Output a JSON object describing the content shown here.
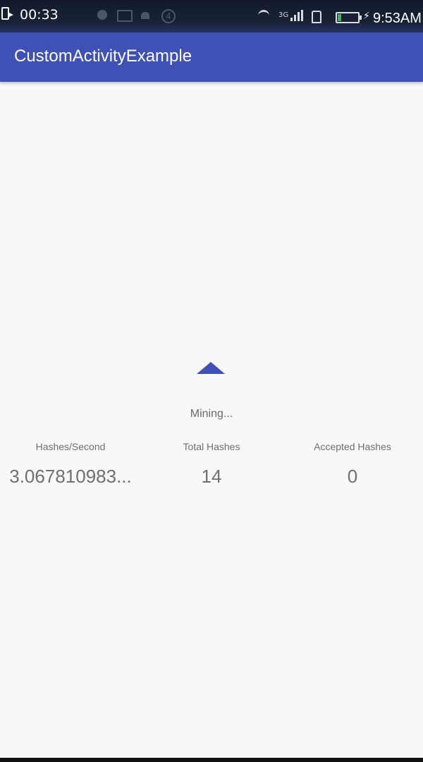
{
  "status_bar": {
    "timer": "00:33",
    "network_type": "3G",
    "notification_count": "4",
    "clock": "9:53AM",
    "battery_color": "#3ab84a"
  },
  "app_bar": {
    "title": "CustomActivityExample",
    "color": "#3f51b5"
  },
  "main": {
    "status_text": "Mining...",
    "stats": [
      {
        "label": "Hashes/Second",
        "value": "3.067810983..."
      },
      {
        "label": "Total Hashes",
        "value": "14"
      },
      {
        "label": "Accepted Hashes",
        "value": "0"
      }
    ]
  }
}
